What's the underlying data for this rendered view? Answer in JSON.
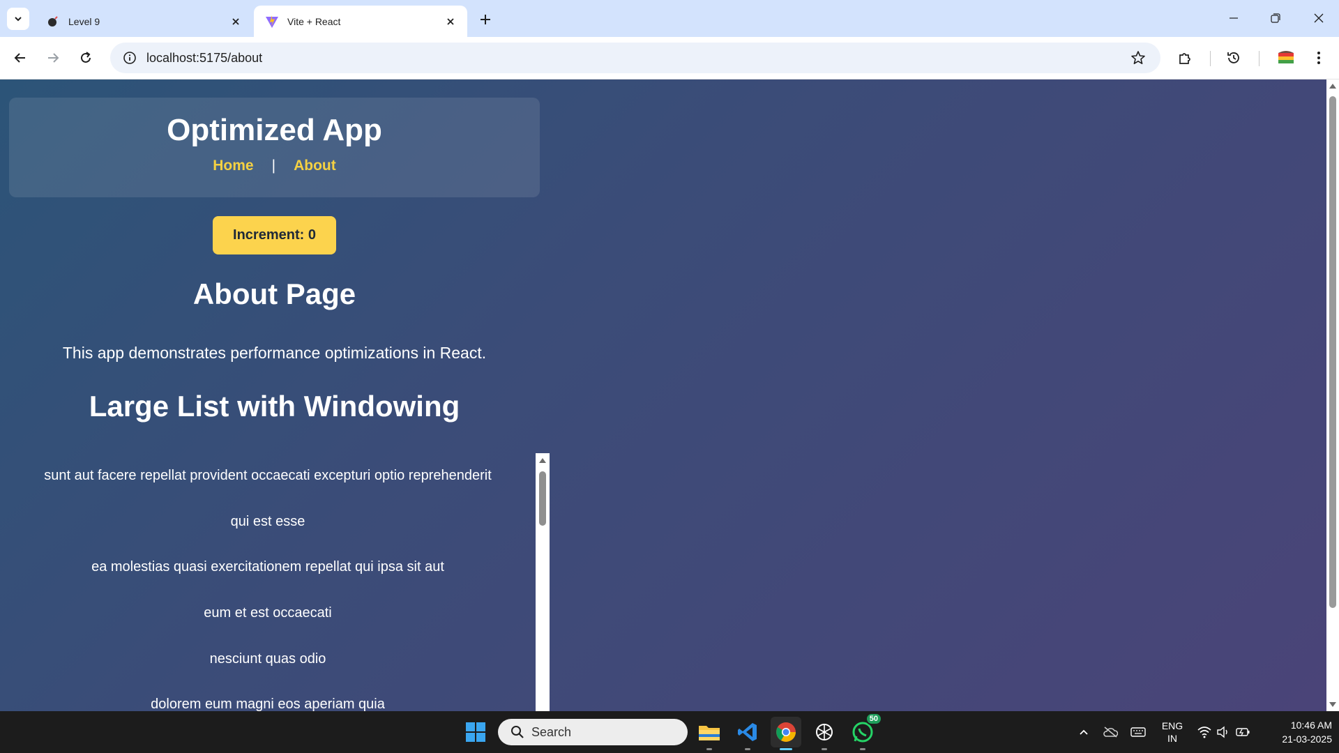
{
  "browser": {
    "tabs": [
      {
        "title": "Level 9",
        "active": false
      },
      {
        "title": "Vite + React",
        "active": true
      }
    ],
    "url": "localhost:5175/about"
  },
  "app": {
    "title": "Optimized App",
    "nav": {
      "home": "Home",
      "separator": "|",
      "about": "About"
    },
    "increment_button": "Increment: 0",
    "about_title": "About Page",
    "about_description": "This app demonstrates performance optimizations in React.",
    "list_title": "Large List with Windowing",
    "list_items": [
      "sunt aut facere repellat provident occaecati excepturi optio reprehenderit",
      "qui est esse",
      "ea molestias quasi exercitationem repellat qui ipsa sit aut",
      "eum et est occaecati",
      "nesciunt quas odio",
      "dolorem eum magni eos aperiam quia"
    ],
    "colors": {
      "accent": "#fcd34d",
      "nav_link": "#f5d142"
    }
  },
  "taskbar": {
    "search_placeholder": "Search",
    "whatsapp_badge": "50",
    "language_line1": "ENG",
    "language_line2": "IN",
    "time": "10:46 AM",
    "date": "21-03-2025"
  }
}
